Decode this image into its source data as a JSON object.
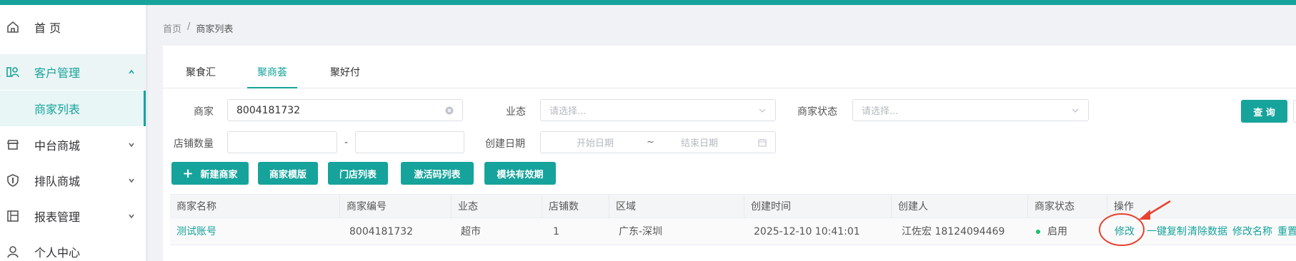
{
  "sidebar": {
    "items": [
      {
        "label": "首 页",
        "icon": "home-icon"
      },
      {
        "label": "客户管理",
        "icon": "customer-icon"
      },
      {
        "label": "中台商城",
        "icon": "shop-icon"
      },
      {
        "label": "排队商城",
        "icon": "shield-icon"
      },
      {
        "label": "报表管理",
        "icon": "report-icon"
      },
      {
        "label": "个人中心",
        "icon": "user-icon"
      }
    ],
    "sub_item": "商家列表"
  },
  "breadcrumb": {
    "home": "首页",
    "sep": "/",
    "current": "商家列表"
  },
  "tabs": [
    "聚食汇",
    "聚商荟",
    "聚好付"
  ],
  "active_tab": "聚商荟",
  "filters": {
    "merchant_label": "商家",
    "merchant_value": "8004181732",
    "business_label": "业态",
    "business_placeholder": "请选择...",
    "status_label": "商家状态",
    "status_placeholder": "请选择...",
    "store_count_label": "店铺数量",
    "range_sep": "-",
    "created_label": "创建日期",
    "start_placeholder": "开始日期",
    "date_sep": "~",
    "end_placeholder": "结束日期",
    "query_button": "查 询"
  },
  "actions": {
    "new_merchant": "新建商家",
    "plus": "+",
    "template": "商家模版",
    "store_list": "门店列表",
    "activation_codes": "激活码列表",
    "module_validity": "模块有效期"
  },
  "table": {
    "columns": [
      "商家名称",
      "商家编号",
      "业态",
      "店铺数",
      "区域",
      "创建时间",
      "创建人",
      "商家状态",
      "操作"
    ],
    "rows": [
      {
        "name": "测试账号",
        "code": "8004181732",
        "business": "超市",
        "stores": "1",
        "region": "广东-深圳",
        "created_at": "2025-12-10 10:41:01",
        "creator": "江佐宏 18124094469",
        "status": "启用",
        "ops": [
          "修改",
          "一键复制",
          "清除数据",
          "修改名称",
          "重置"
        ]
      }
    ]
  },
  "colors": {
    "accent": "#16a39b",
    "annotation": "#e8412f",
    "status_ok": "#19be6b"
  }
}
